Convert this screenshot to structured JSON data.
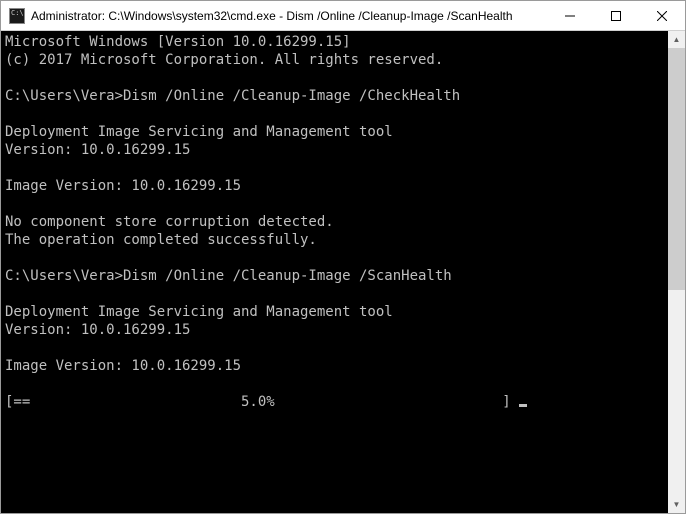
{
  "window": {
    "title": "Administrator: C:\\Windows\\system32\\cmd.exe - Dism  /Online /Cleanup-Image /ScanHealth"
  },
  "terminal": {
    "lines": [
      "Microsoft Windows [Version 10.0.16299.15]",
      "(c) 2017 Microsoft Corporation. All rights reserved.",
      "",
      "C:\\Users\\Vera>Dism /Online /Cleanup-Image /CheckHealth",
      "",
      "Deployment Image Servicing and Management tool",
      "Version: 10.0.16299.15",
      "",
      "Image Version: 10.0.16299.15",
      "",
      "No component store corruption detected.",
      "The operation completed successfully.",
      "",
      "C:\\Users\\Vera>Dism /Online /Cleanup-Image /ScanHealth",
      "",
      "Deployment Image Servicing and Management tool",
      "Version: 10.0.16299.15",
      "",
      "Image Version: 10.0.16299.15",
      ""
    ],
    "progress_line": "[==                         5.0%                           ] ",
    "progress_percent": 5.0
  },
  "scrollbar": {
    "up": "▲",
    "down": "▼"
  }
}
